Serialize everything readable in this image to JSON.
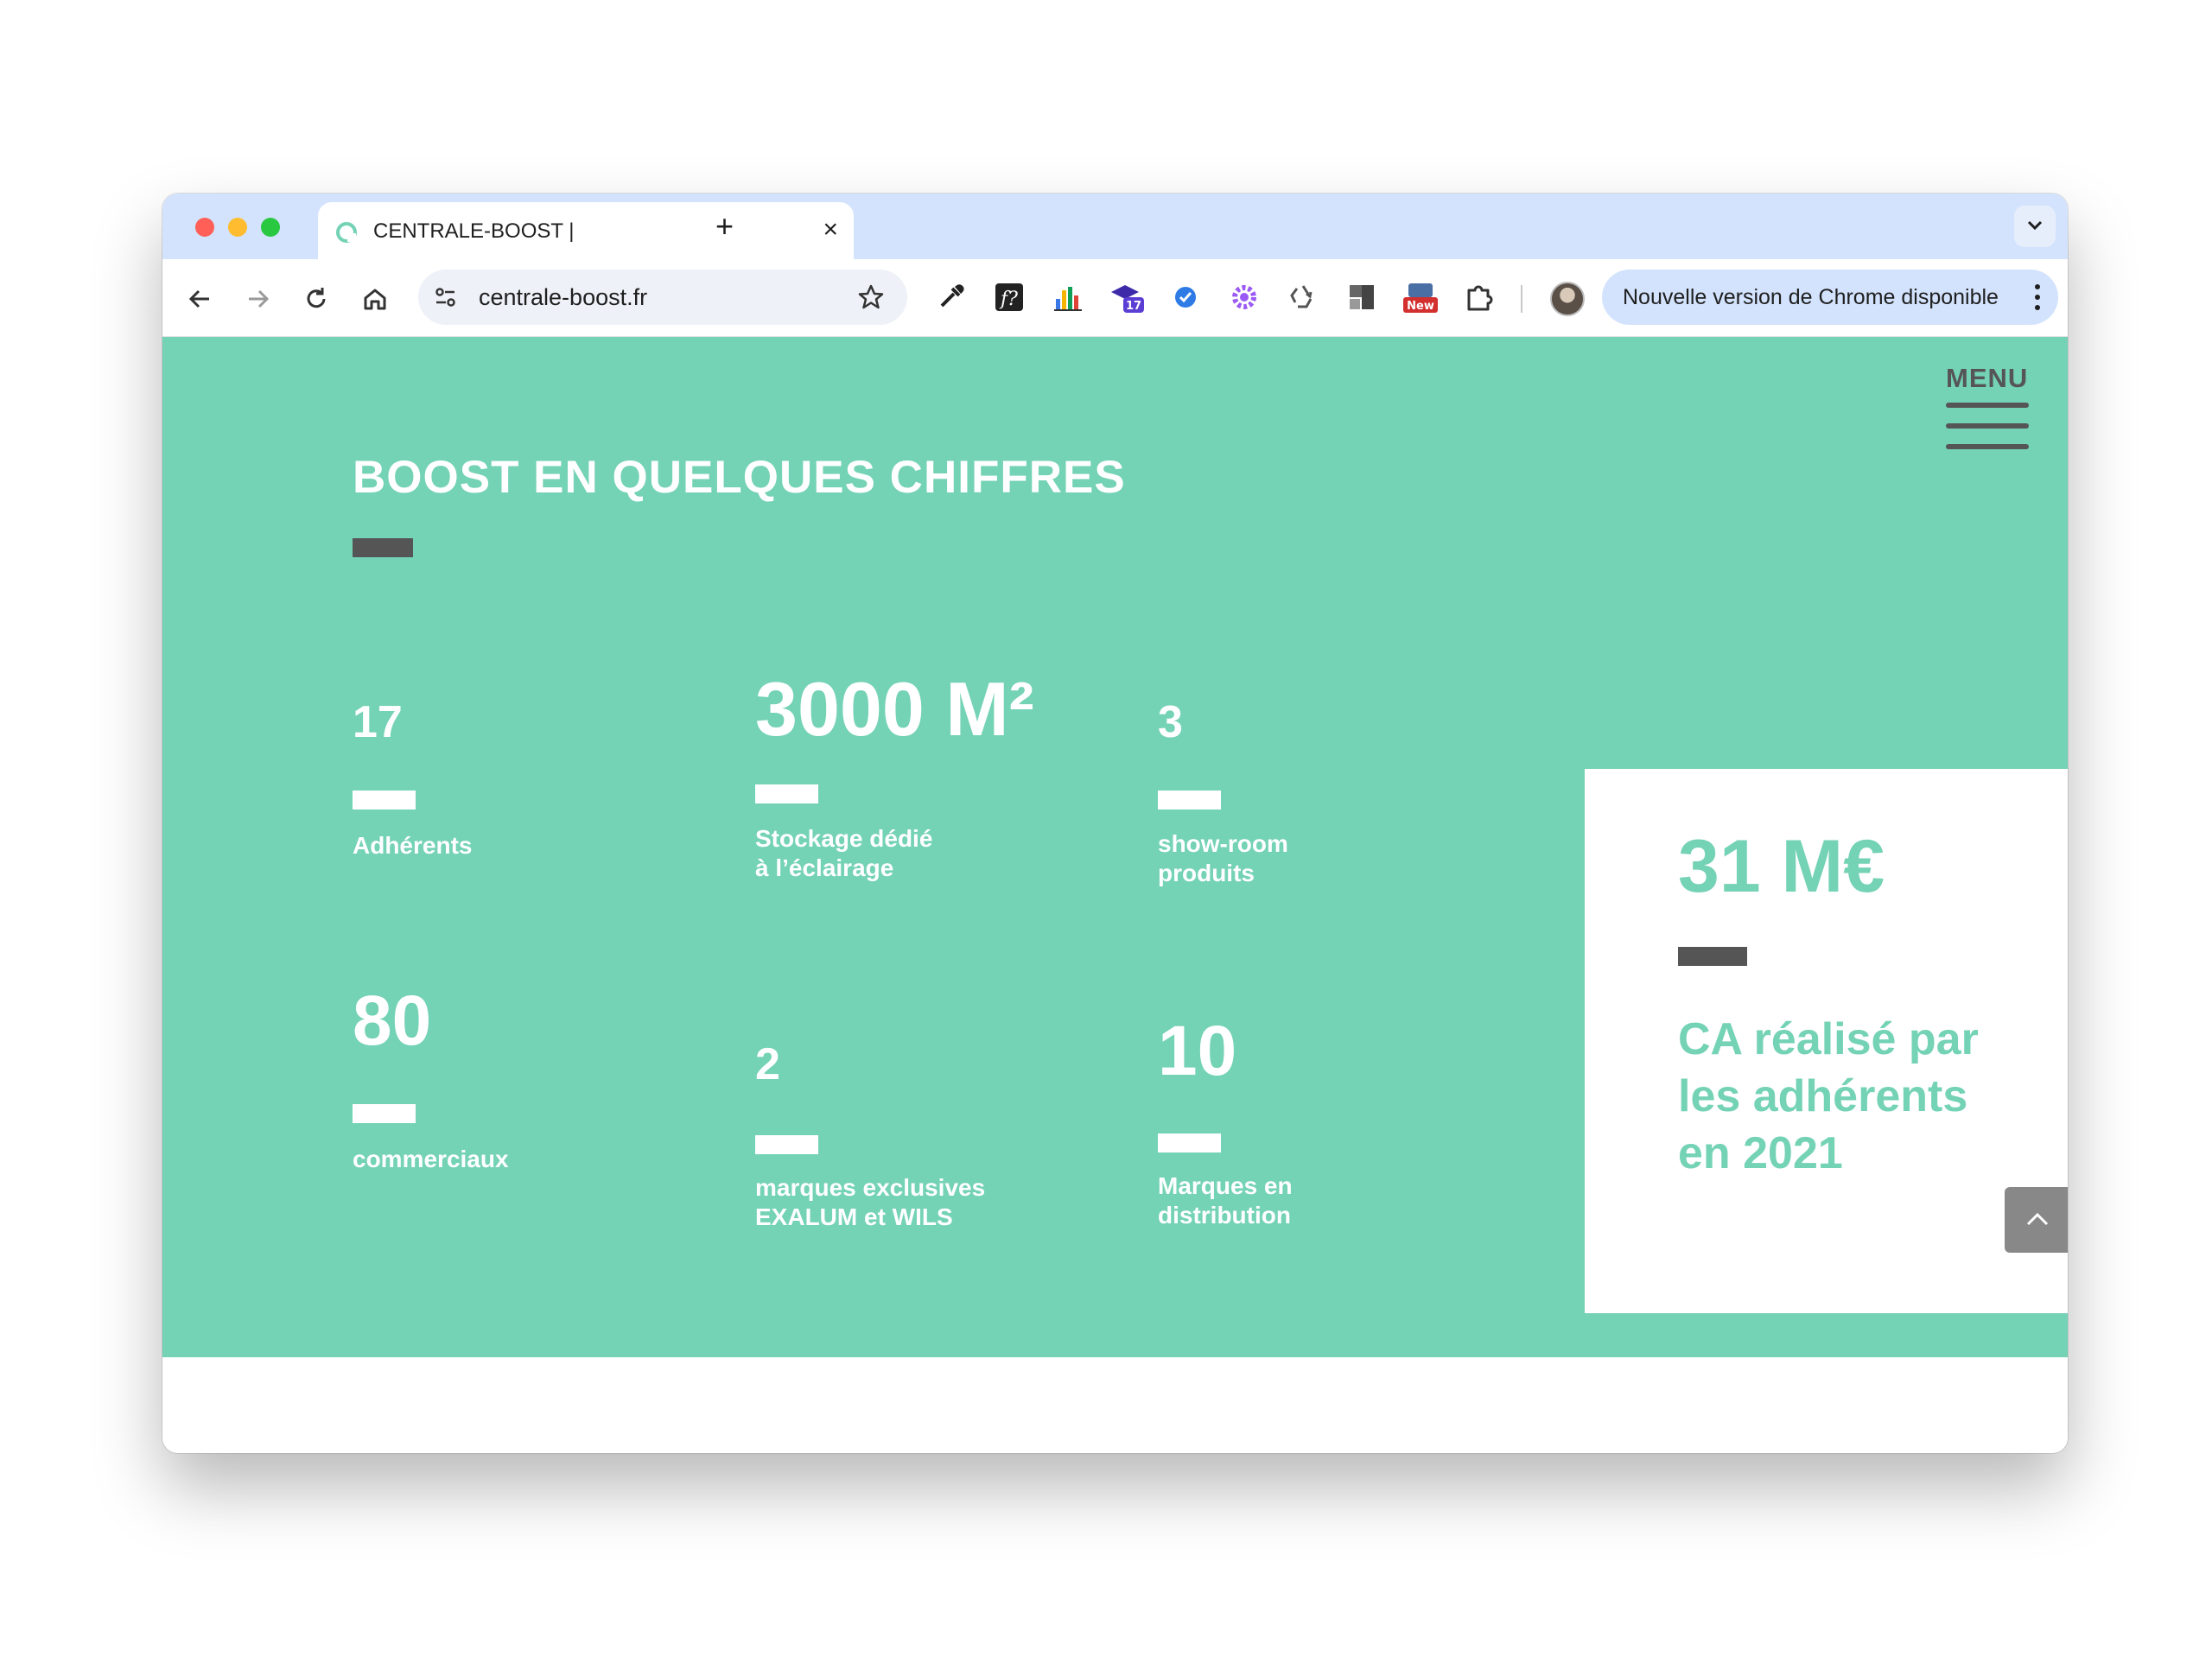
{
  "browser": {
    "tab_title": "CENTRALE-BOOST |",
    "url": "centrale-boost.fr",
    "update_text": "Nouvelle version de Chrome disponible",
    "extension_badges": {
      "calendar": "17",
      "new": "New"
    }
  },
  "site": {
    "menu_label": "MENU",
    "heading": "BOOST EN QUELQUES CHIFFRES",
    "stats": [
      {
        "value": "17",
        "label": "Adhérents"
      },
      {
        "value": "3000 M²",
        "label_line1": "Stockage dédié",
        "label_line2": "à l’éclairage"
      },
      {
        "value": "3",
        "label_line1": "show-room",
        "label_line2": "produits"
      },
      {
        "value": "80",
        "label": "commerciaux"
      },
      {
        "value": "2",
        "label_line1": "marques exclusives",
        "label_line2": "EXALUM et WILS"
      },
      {
        "value": "10",
        "label_line1": "Marques en",
        "label_line2": "distribution"
      }
    ],
    "card": {
      "value": "31 M€",
      "text": "CA réalisé par les adhérents en 2021"
    }
  },
  "colors": {
    "brand_green": "#74d2b5",
    "dark_grey": "#555555",
    "tab_strip": "#d3e3fd"
  }
}
